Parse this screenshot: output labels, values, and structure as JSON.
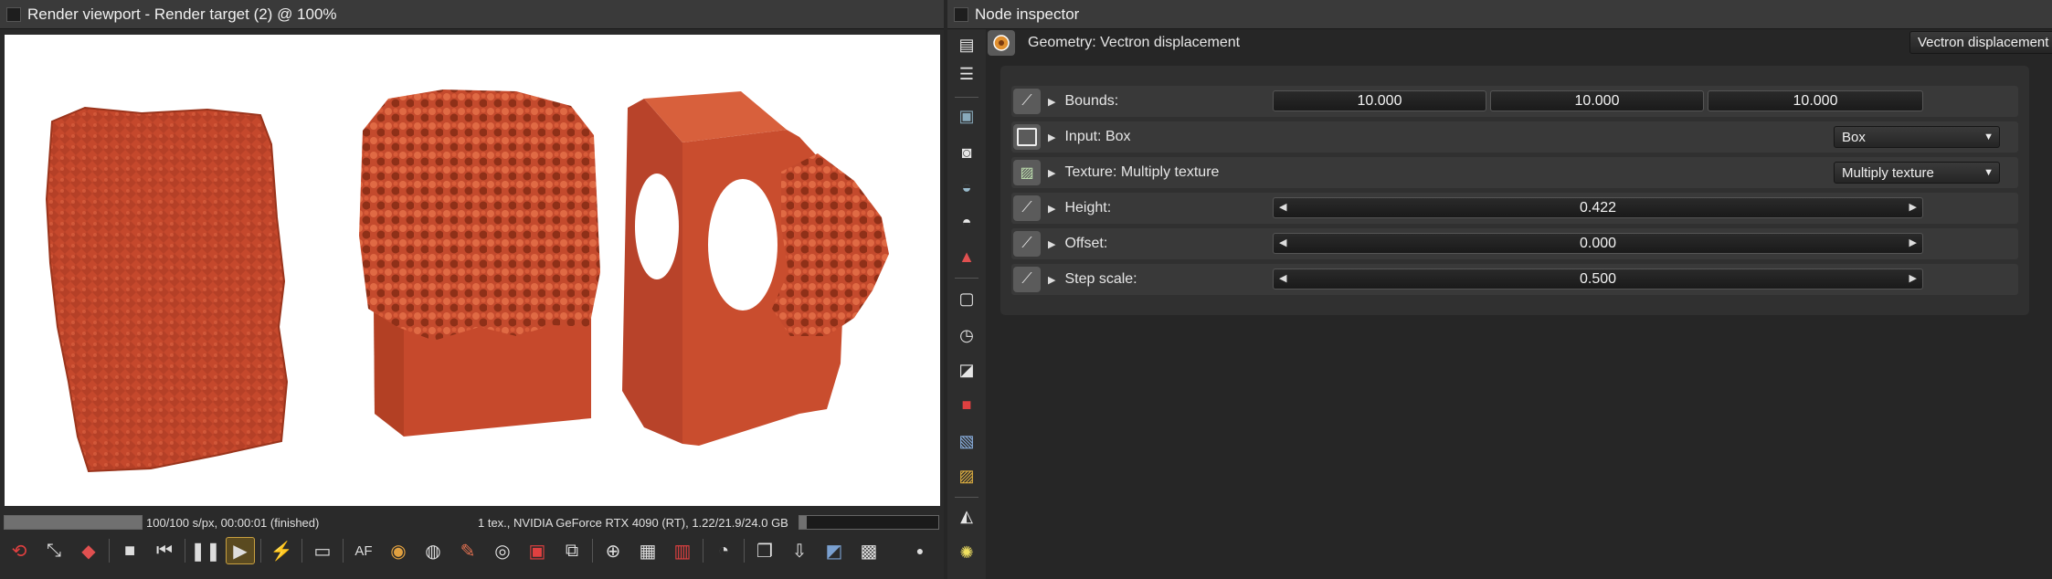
{
  "viewport": {
    "title": "Render viewport - Render target (2) @ 100%",
    "status_left": "100/100 s/px, 00:00:01 (finished)",
    "status_right": "1 tex., NVIDIA GeForce RTX 4090 (RT), 1.22/21.9/24.0 GB",
    "progress": 1.0,
    "memory_fraction": 0.05,
    "toolbar_icons": [
      "recycle-icon",
      "fit-icon",
      "cube-icon",
      "stop-icon",
      "rewind-icon",
      "pause-icon",
      "play-icon",
      "lightning-icon",
      "monitor-icon",
      "af-icon",
      "color-wheel-icon",
      "sphere-icon",
      "brush-icon",
      "camera-pick-icon",
      "region-icon",
      "render-region-icon",
      "globe-settings-icon",
      "grid-icon",
      "film-icon",
      "gauge-icon",
      "copy-icon",
      "save-icon",
      "export-icon",
      "checker-icon",
      "dot-icon"
    ],
    "af_label": "AF"
  },
  "inspector": {
    "title": "Node inspector",
    "node_label": "Geometry: Vectron displacement",
    "node_type": "Vectron displacement",
    "rows": [
      {
        "label": "Bounds:",
        "values": [
          "10.000",
          "10.000",
          "10.000"
        ]
      },
      {
        "label": "Input: Box",
        "dropdown": "Box"
      },
      {
        "label": "Texture: Multiply texture",
        "dropdown": "Multiply texture"
      },
      {
        "label": "Height:",
        "value": "0.422"
      },
      {
        "label": "Offset:",
        "value": "0.000"
      },
      {
        "label": "Step scale:",
        "value": "0.500"
      }
    ]
  },
  "colors": {
    "accent": "#c8a040",
    "object": "#c24a2e",
    "background": "#262626"
  }
}
